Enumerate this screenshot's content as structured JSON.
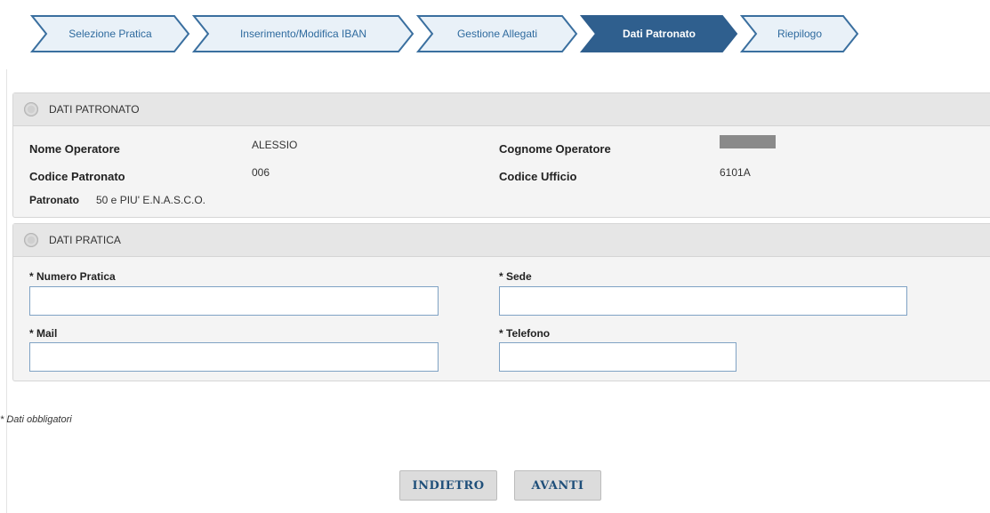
{
  "wizard": {
    "steps": [
      {
        "label": "Selezione Pratica",
        "active": false
      },
      {
        "label": "Inserimento/Modifica IBAN",
        "active": false
      },
      {
        "label": "Gestione Allegati",
        "active": false
      },
      {
        "label": "Dati Patronato",
        "active": true
      },
      {
        "label": "Riepilogo",
        "active": false
      }
    ]
  },
  "dati_patronato": {
    "title": "DATI PATRONATO",
    "nome_operatore_label": "Nome Operatore",
    "nome_operatore_value": "ALESSIO",
    "cognome_operatore_label": "Cognome Operatore",
    "codice_patronato_label": "Codice Patronato",
    "codice_patronato_value": "006",
    "codice_ufficio_label": "Codice Ufficio",
    "codice_ufficio_value": "6101A",
    "patronato_label": "Patronato",
    "patronato_value": "50 e PIU' E.N.A.S.C.O."
  },
  "dati_pratica": {
    "title": "DATI PRATICA",
    "numero_pratica_label": "* Numero Pratica",
    "numero_pratica_value": "",
    "sede_label": "* Sede",
    "sede_value": "",
    "mail_label": "* Mail",
    "mail_value": "",
    "telefono_label": "* Telefono",
    "telefono_value": ""
  },
  "footer": {
    "required_note": "* Dati obbligatori",
    "back_label": "INDIETRO",
    "next_label": "AVANTI"
  },
  "colors": {
    "step_fill": "#e9f1f8",
    "step_border": "#3a6f9f",
    "step_active_fill": "#2f5f8e",
    "step_text": "#2e6a9e",
    "button_text": "#1f4f7a"
  }
}
